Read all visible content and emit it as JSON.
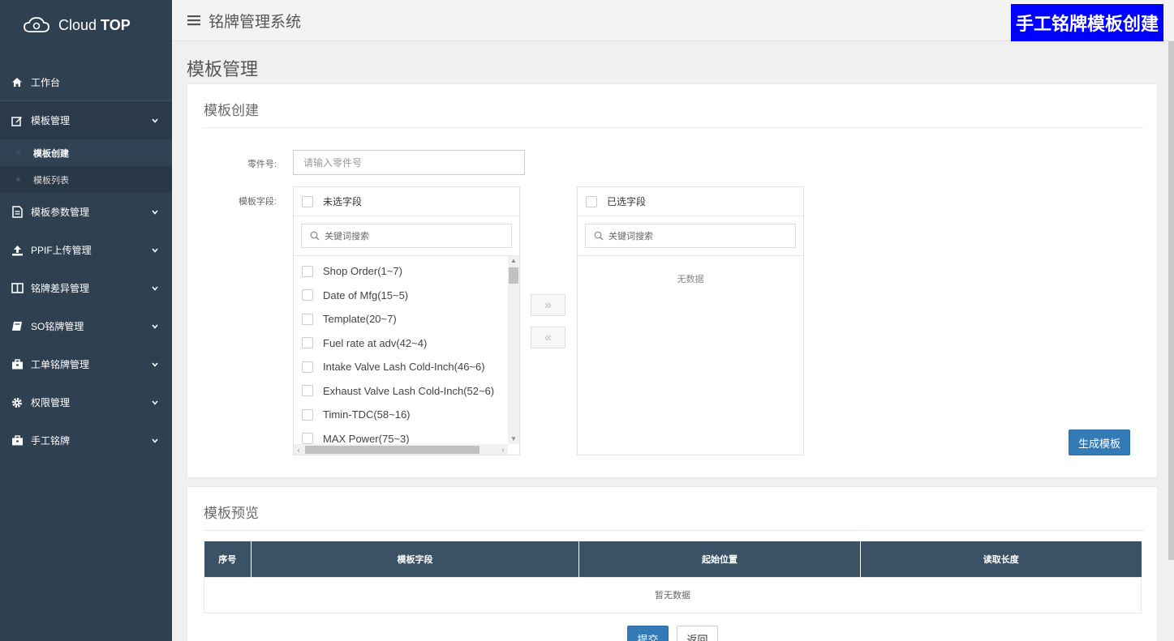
{
  "brand": {
    "name_light": "Cloud",
    "name_bold": "TOP"
  },
  "header": {
    "system_title": "铭牌管理系统",
    "badge": "手工铭牌模板创建"
  },
  "sidebar": {
    "items": [
      {
        "label": "工作台",
        "icon": "home-icon"
      },
      {
        "label": "模板管理",
        "icon": "edit-icon"
      },
      {
        "label": "模板参数管理",
        "icon": "document-icon"
      },
      {
        "label": "PPIF上传管理",
        "icon": "upload-icon"
      },
      {
        "label": "铭牌差异管理",
        "icon": "columns-icon"
      },
      {
        "label": "SO铭牌管理",
        "icon": "book-icon"
      },
      {
        "label": "工单铭牌管理",
        "icon": "briefcase-icon"
      },
      {
        "label": "权限管理",
        "icon": "gear-icon"
      },
      {
        "label": "手工铭牌",
        "icon": "briefcase-icon"
      }
    ],
    "subitems": [
      {
        "label": "模板创建",
        "active": true
      },
      {
        "label": "模板列表",
        "active": false
      }
    ]
  },
  "page": {
    "title": "模板管理"
  },
  "create_panel": {
    "title": "模板创建",
    "part_label": "零件号:",
    "part_placeholder": "请输入零件号",
    "fields_label": "模板字段:",
    "left_box": {
      "header": "未选字段",
      "search_placeholder": "关键词搜索",
      "items": [
        "Shop Order(1~7)",
        "Date of Mfg(15~5)",
        "Template(20~7)",
        "Fuel rate at adv(42~4)",
        "Intake Valve Lash Cold-Inch(46~6)",
        "Exhaust Valve Lash Cold-Inch(52~6)",
        "Timin-TDC(58~16)",
        "MAX Power(75~3)"
      ]
    },
    "right_box": {
      "header": "已选字段",
      "search_placeholder": "关键词搜索",
      "empty_text": "无数据"
    },
    "move_right": "»",
    "move_left": "«",
    "generate_button": "生成模板"
  },
  "preview_panel": {
    "title": "模板预览",
    "columns": [
      "序号",
      "模板字段",
      "起始位置",
      "读取长度"
    ],
    "empty_text": "暂无数据",
    "submit_button": "提交",
    "back_button": "返回"
  },
  "colors": {
    "sidebar": "#2f4050",
    "primary": "#337ab7",
    "badge": "#0000ff",
    "table_header": "#3a5166"
  }
}
